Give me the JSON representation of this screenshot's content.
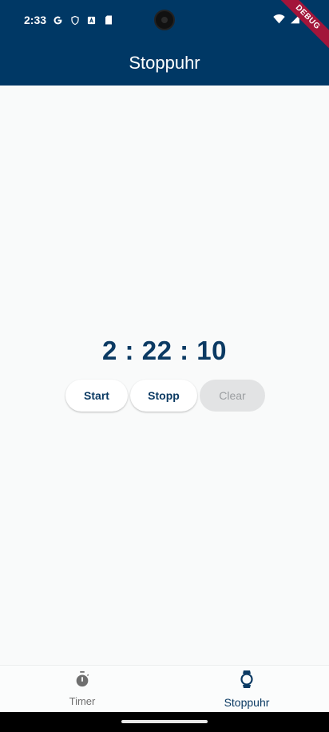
{
  "status": {
    "time": "2:33",
    "debug_label": "DEBUG"
  },
  "app_bar": {
    "title": "Stoppuhr"
  },
  "stopwatch": {
    "display": "2 : 22 : 10",
    "start_label": "Start",
    "stop_label": "Stopp",
    "clear_label": "Clear"
  },
  "nav": {
    "items": [
      {
        "label": "Timer",
        "icon": "timer-icon",
        "active": false
      },
      {
        "label": "Stoppuhr",
        "icon": "watch-icon",
        "active": true
      }
    ]
  },
  "colors": {
    "primary": "#003865",
    "text_primary": "#0b3a63",
    "background": "#f9fafa"
  }
}
